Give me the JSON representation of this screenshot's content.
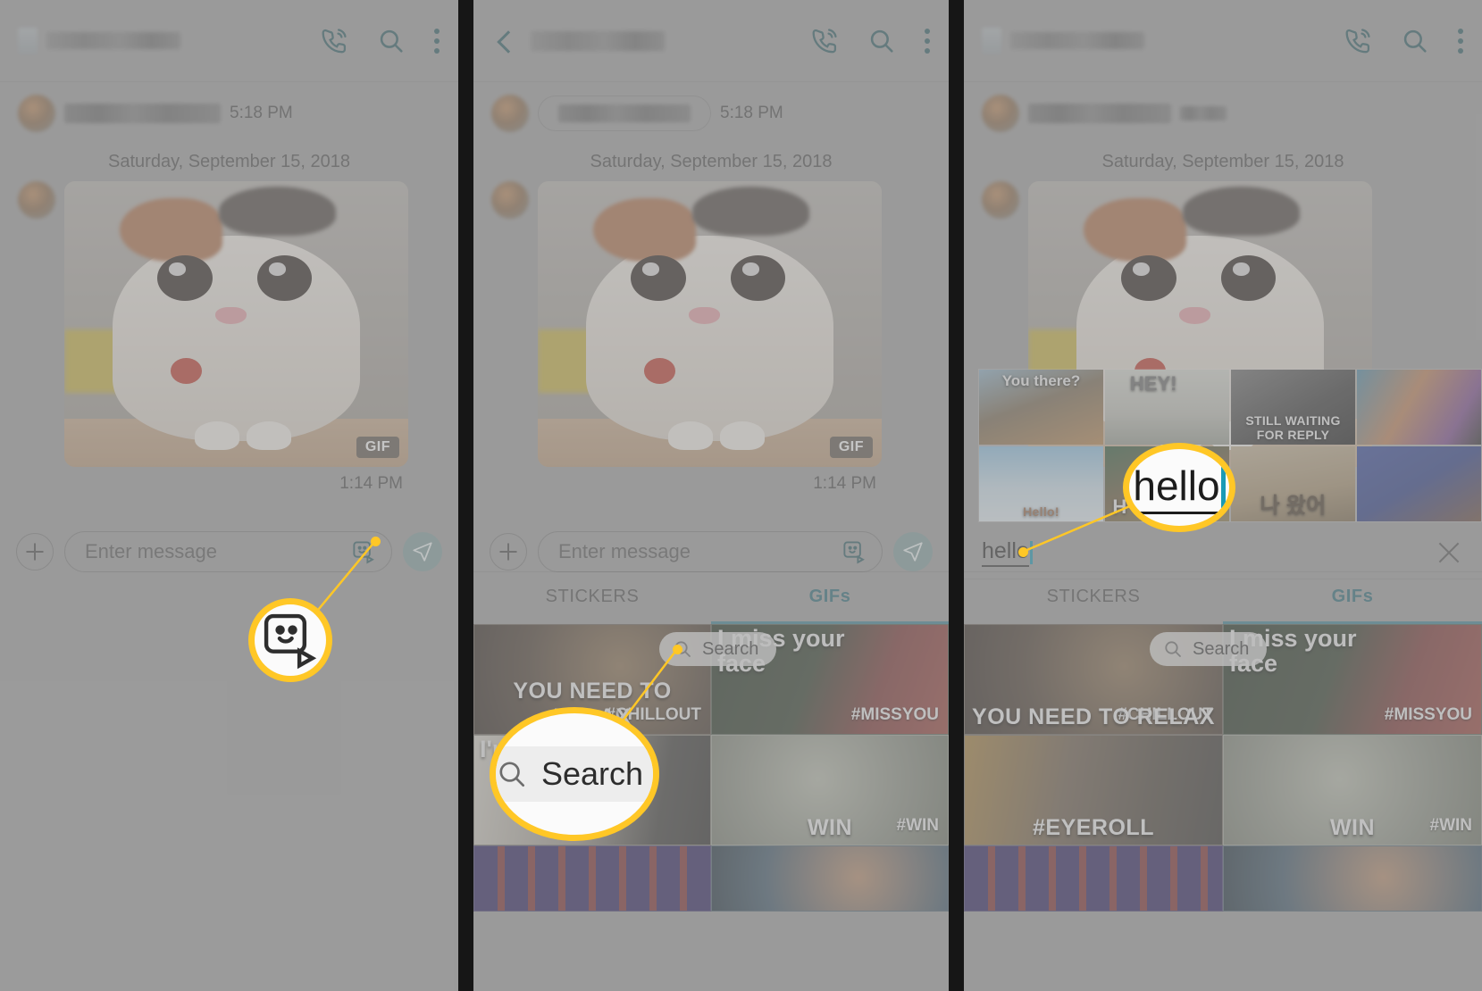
{
  "app": {
    "name": "Samsung Messages",
    "accent_color": "#2b5b63",
    "highlight_color": "#ffc726"
  },
  "panels": [
    {
      "id": "panel-1",
      "header": {
        "title_redacted": true,
        "icons": [
          "video-call-icon",
          "search-icon",
          "more-options-icon"
        ]
      },
      "conversation": {
        "incoming_time": "5:18 PM",
        "date_separator": "Saturday, September 15, 2018",
        "gif_badge": "GIF",
        "gif_time": "1:14 PM"
      },
      "composer": {
        "placeholder": "Enter message",
        "add_label": "+",
        "sticker_icon": "sticker-gif-icon",
        "send_icon": "send-icon"
      },
      "callout": {
        "type": "sticker-gif-icon",
        "label": ""
      }
    },
    {
      "id": "panel-2",
      "header": {
        "back_icon": "back-arrow-icon",
        "title_redacted": true,
        "icons": [
          "video-call-icon",
          "search-icon",
          "more-options-icon"
        ]
      },
      "conversation": {
        "incoming_time": "5:18 PM",
        "date_separator": "Saturday, September 15, 2018",
        "gif_badge": "GIF",
        "gif_time": "1:14 PM"
      },
      "composer": {
        "placeholder": "Enter message"
      },
      "tray": {
        "tabs": [
          {
            "label": "STICKERS",
            "active": false
          },
          {
            "label": "GIFs",
            "active": true
          }
        ],
        "search_pill_label": "Search",
        "grid": [
          {
            "tag": "#CHILLOUT",
            "caption": "YOU NEED TO RELAX",
            "cap_top": "",
            "bg": "#4b4036"
          },
          {
            "tag": "#MISSYOU",
            "caption": "",
            "cap_top": "I miss your face",
            "bg": "#2c3a2a"
          },
          {
            "tag": "",
            "caption": "",
            "cap_top": "I'm you fa",
            "bg": "#6a6459"
          },
          {
            "tag": "#WIN",
            "caption": "WIN",
            "cap_top": "",
            "bg": "#8c9184"
          },
          {
            "tag": "",
            "caption": "",
            "cap_top": "",
            "bg": "#241a52"
          },
          {
            "tag": "",
            "caption": "",
            "cap_top": "",
            "bg": "#2b4454"
          }
        ]
      },
      "callout": {
        "type": "search-pill",
        "label": "Search"
      }
    },
    {
      "id": "panel-3",
      "header": {
        "title_redacted": true,
        "icons": [
          "video-call-icon",
          "search-icon",
          "more-options-icon"
        ]
      },
      "conversation": {
        "date_separator": "Saturday, September 15, 2018"
      },
      "search": {
        "value": "hello",
        "clear_icon": "close-icon"
      },
      "results": [
        {
          "top": "You there?",
          "bottom": "",
          "bg": "#6b7f8c"
        },
        {
          "top": "",
          "bottom": "HEY!",
          "bg": "#c9cbc4"
        },
        {
          "top": "",
          "bottom": "STILL WAITING FOR REPLY",
          "bg": "#3a3a3a"
        },
        {
          "top": "",
          "bottom": "",
          "bg": "#8f5f4a"
        },
        {
          "top": "",
          "bottom": "Hello!",
          "bg": "#9fc6e0"
        },
        {
          "top": "",
          "bottom": "H",
          "bg": "#5b6b3a"
        },
        {
          "top": "",
          "bottom": "나 왔어",
          "bg": "#b9a88d"
        },
        {
          "top": "",
          "bottom": "",
          "bg": "#2c3f8c"
        }
      ],
      "tray": {
        "tabs": [
          {
            "label": "STICKERS",
            "active": false
          },
          {
            "label": "GIFs",
            "active": true
          }
        ],
        "search_pill_label": "Search",
        "grid": [
          {
            "tag": "#CHILLOUT",
            "caption": "YOU NEED TO RELAX",
            "cap_top": "",
            "bg": "#4b4036"
          },
          {
            "tag": "#MISSYOU",
            "caption": "",
            "cap_top": "I miss your face",
            "bg": "#2c3a2a"
          },
          {
            "tag": "#EYEROLL",
            "caption": "",
            "cap_top": "",
            "bg": "#5a5046"
          },
          {
            "tag": "#WIN",
            "caption": "WIN",
            "cap_top": "",
            "bg": "#8c9184"
          },
          {
            "tag": "",
            "caption": "",
            "cap_top": "",
            "bg": "#241a52"
          },
          {
            "tag": "",
            "caption": "",
            "cap_top": "",
            "bg": "#2b4454"
          }
        ]
      },
      "callout": {
        "type": "text-input",
        "label": "hello"
      }
    }
  ]
}
